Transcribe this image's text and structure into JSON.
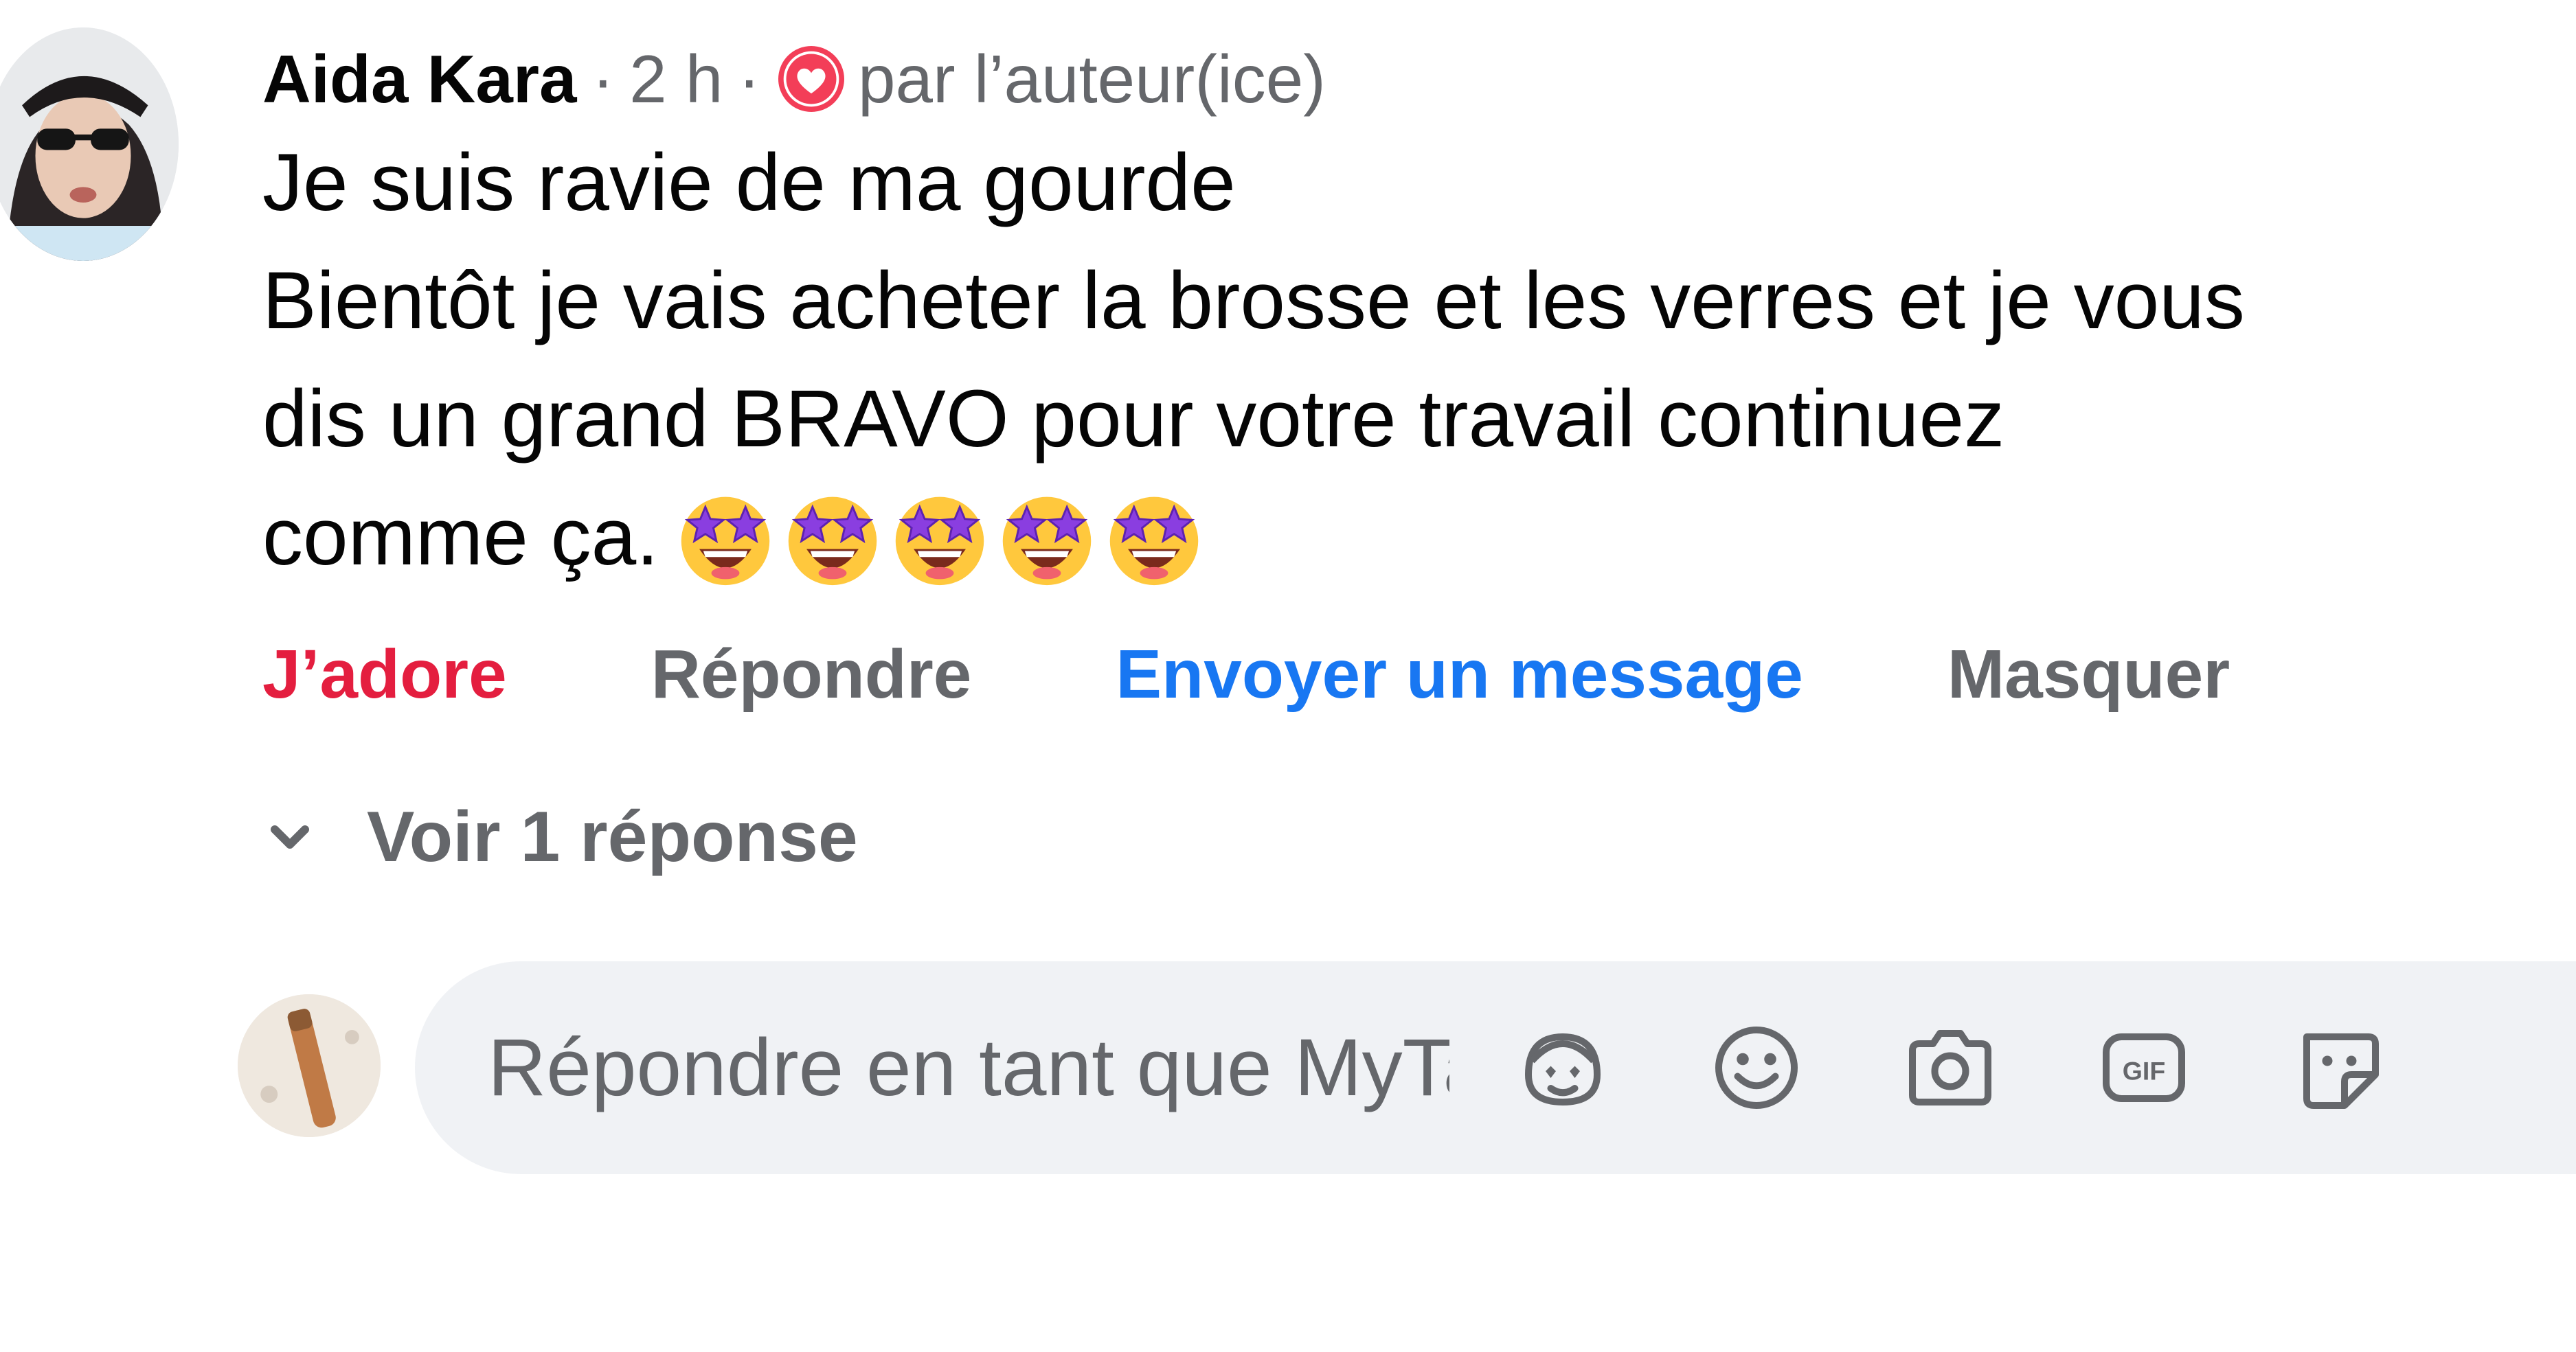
{
  "comment": {
    "author": "Aida Kara",
    "separator": "·",
    "time": "2 h",
    "author_tag": "par l’auteur(ice)",
    "body_lines": [
      "Je suis ravie de ma gourde",
      "Bientôt je vais acheter la brosse et les verres et je vous",
      "dis un grand BRAVO pour votre travail continuez",
      "comme ça."
    ],
    "emoji_count": 5,
    "emoji_icon": "star-struck-emoji"
  },
  "actions": {
    "love": "J’adore",
    "reply": "Répondre",
    "message": "Envoyer un message",
    "hide": "Masquer"
  },
  "replies": {
    "toggle_label": "Voir 1 réponse"
  },
  "composer": {
    "placeholder": "Répondre en tant que MyTa...",
    "icons": [
      "avatar-sticker-icon",
      "emoji-icon",
      "camera-icon",
      "gif-icon",
      "sticker-icon"
    ]
  },
  "colors": {
    "love": "#e41e3f",
    "link": "#1877f2",
    "muted": "#65676b",
    "composer_bg": "#f0f2f5"
  }
}
